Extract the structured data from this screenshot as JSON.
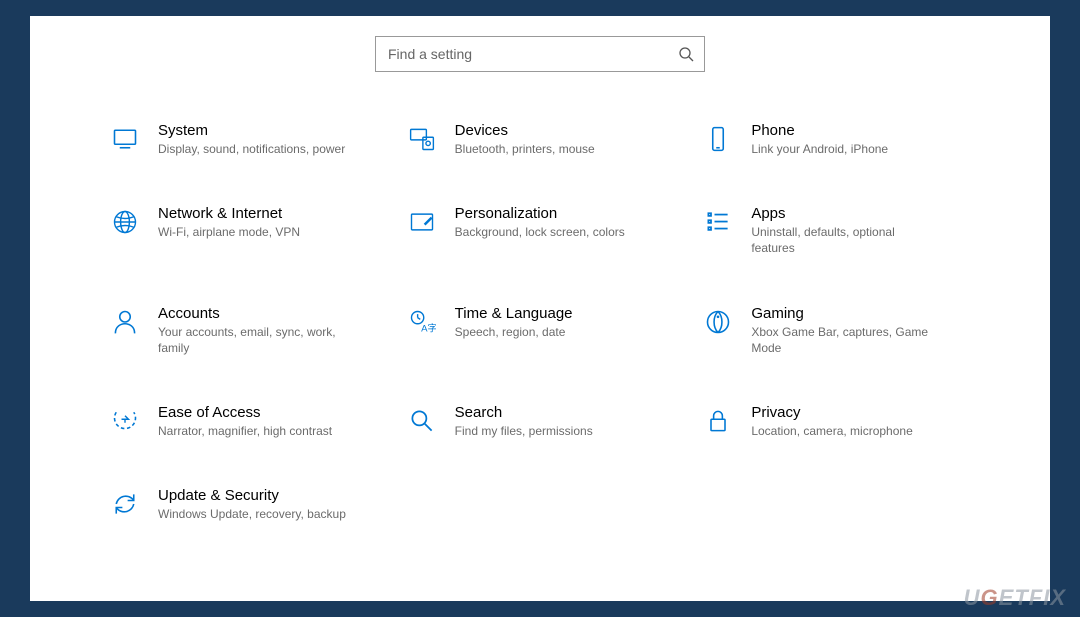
{
  "search": {
    "placeholder": "Find a setting"
  },
  "categories": [
    {
      "id": "system",
      "title": "System",
      "desc": "Display, sound, notifications, power"
    },
    {
      "id": "devices",
      "title": "Devices",
      "desc": "Bluetooth, printers, mouse"
    },
    {
      "id": "phone",
      "title": "Phone",
      "desc": "Link your Android, iPhone"
    },
    {
      "id": "network",
      "title": "Network & Internet",
      "desc": "Wi-Fi, airplane mode, VPN"
    },
    {
      "id": "personalization",
      "title": "Personalization",
      "desc": "Background, lock screen, colors"
    },
    {
      "id": "apps",
      "title": "Apps",
      "desc": "Uninstall, defaults, optional features"
    },
    {
      "id": "accounts",
      "title": "Accounts",
      "desc": "Your accounts, email, sync, work, family"
    },
    {
      "id": "time-language",
      "title": "Time & Language",
      "desc": "Speech, region, date"
    },
    {
      "id": "gaming",
      "title": "Gaming",
      "desc": "Xbox Game Bar, captures, Game Mode"
    },
    {
      "id": "ease-of-access",
      "title": "Ease of Access",
      "desc": "Narrator, magnifier, high contrast"
    },
    {
      "id": "search",
      "title": "Search",
      "desc": "Find my files, permissions"
    },
    {
      "id": "privacy",
      "title": "Privacy",
      "desc": "Location, camera, microphone"
    },
    {
      "id": "update-security",
      "title": "Update & Security",
      "desc": "Windows Update, recovery, backup"
    }
  ],
  "watermark": "UGETFIX"
}
